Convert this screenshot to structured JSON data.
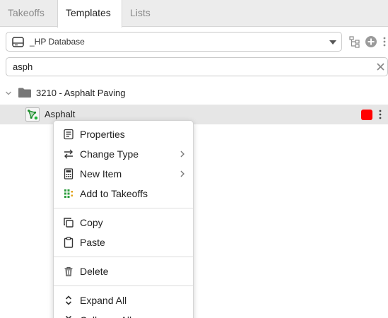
{
  "tabs": [
    {
      "label": "Takeoffs"
    },
    {
      "label": "Templates"
    },
    {
      "label": "Lists"
    }
  ],
  "active_tab": "Templates",
  "database": {
    "selected": "_HP Database",
    "icon": "database-drive-icon"
  },
  "toolbar": {
    "icons": [
      "tree-structure-icon",
      "add-circle-icon",
      "more-vertical-icon"
    ]
  },
  "search": {
    "value": "asph",
    "clear_icon": "close-icon"
  },
  "tree": {
    "folder": {
      "label": "3210 - Asphalt Paving",
      "expanded": true
    },
    "item": {
      "label": "Asphalt",
      "color": "#ff0000",
      "selected": true
    }
  },
  "context_menu": {
    "items": [
      {
        "label": "Properties",
        "icon": "properties-icon"
      },
      {
        "label": "Change Type",
        "icon": "swap-arrows-icon",
        "submenu": true
      },
      {
        "label": "New Item",
        "icon": "calculator-icon",
        "submenu": true
      },
      {
        "label": "Add to Takeoffs",
        "icon": "add-takeoff-icon"
      },
      {
        "label": "Copy",
        "icon": "copy-icon"
      },
      {
        "label": "Paste",
        "icon": "clipboard-icon"
      },
      {
        "label": "Delete",
        "icon": "trash-icon"
      },
      {
        "label": "Expand All",
        "icon": "expand-icon"
      },
      {
        "label": "Collapse All",
        "icon": "collapse-icon"
      }
    ]
  }
}
